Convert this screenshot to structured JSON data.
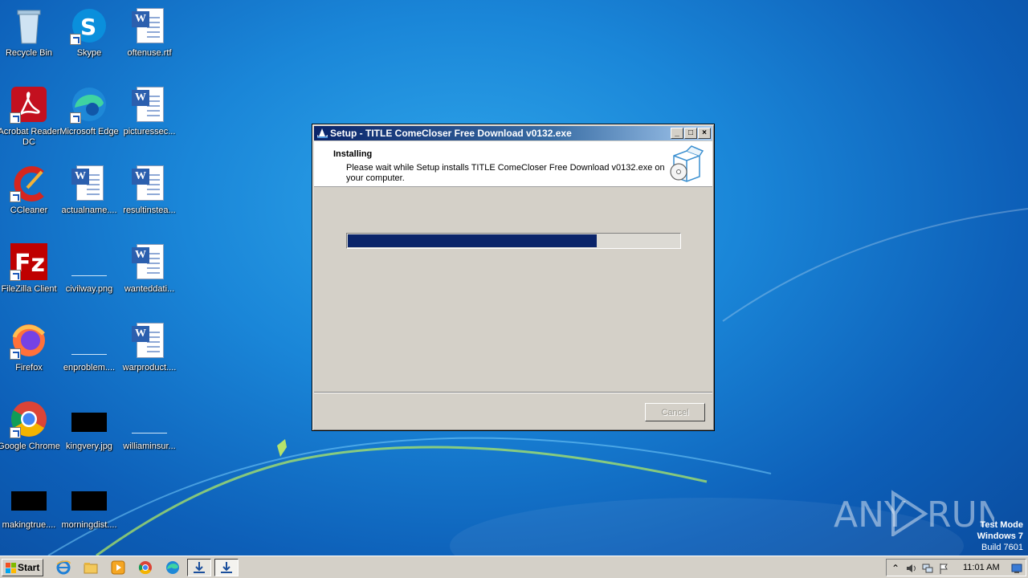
{
  "desktop_icons": [
    {
      "label": "Recycle Bin",
      "icon": "recycle-bin-icon"
    },
    {
      "label": "Skype",
      "icon": "skype-icon"
    },
    {
      "label": "oftenuse.rtf",
      "icon": "word-document-icon"
    },
    {
      "label": "Acrobat Reader DC",
      "icon": "acrobat-reader-icon"
    },
    {
      "label": "Microsoft Edge",
      "icon": "edge-icon"
    },
    {
      "label": "picturessec...",
      "icon": "word-document-icon"
    },
    {
      "label": "CCleaner",
      "icon": "ccleaner-icon"
    },
    {
      "label": "actualname....",
      "icon": "word-document-icon"
    },
    {
      "label": "resultinstea...",
      "icon": "word-document-icon"
    },
    {
      "label": "FileZilla Client",
      "icon": "filezilla-icon"
    },
    {
      "label": "civilway.png",
      "icon": "image-file-icon"
    },
    {
      "label": "wanteddati...",
      "icon": "word-document-icon"
    },
    {
      "label": "Firefox",
      "icon": "firefox-icon"
    },
    {
      "label": "enproblem....",
      "icon": "image-file-icon"
    },
    {
      "label": "warproduct....",
      "icon": "word-document-icon"
    },
    {
      "label": "Google Chrome",
      "icon": "chrome-icon"
    },
    {
      "label": "kingvery.jpg",
      "icon": "image-file-icon"
    },
    {
      "label": "williaminsur...",
      "icon": "image-file-icon"
    },
    {
      "label": "makingtrue....",
      "icon": "image-file-icon"
    },
    {
      "label": "morningdist....",
      "icon": "image-file-icon"
    }
  ],
  "setup": {
    "title": "Setup - TITLE ComeCloser Free Download v0132.exe",
    "heading": "Installing",
    "description": "Please wait while Setup installs TITLE ComeCloser Free Download v0132.exe on your computer.",
    "progress_fraction": 0.75,
    "cancel_label": "Cancel",
    "minimize_glyph": "_",
    "maximize_glyph": "□",
    "close_glyph": "×"
  },
  "taskbar": {
    "start_label": "Start",
    "clock": "11:01 AM",
    "tray_expand_glyph": "⌃"
  },
  "watermark": {
    "brand_left": "ANY",
    "brand_right": "RUN",
    "test_mode": "Test Mode",
    "os_name": "Windows 7",
    "build": "Build 7601"
  },
  "colors": {
    "progress_fill": "#0a246a",
    "title_bar_start": "#0a246a",
    "desktop_blue": "#1a86d8"
  }
}
